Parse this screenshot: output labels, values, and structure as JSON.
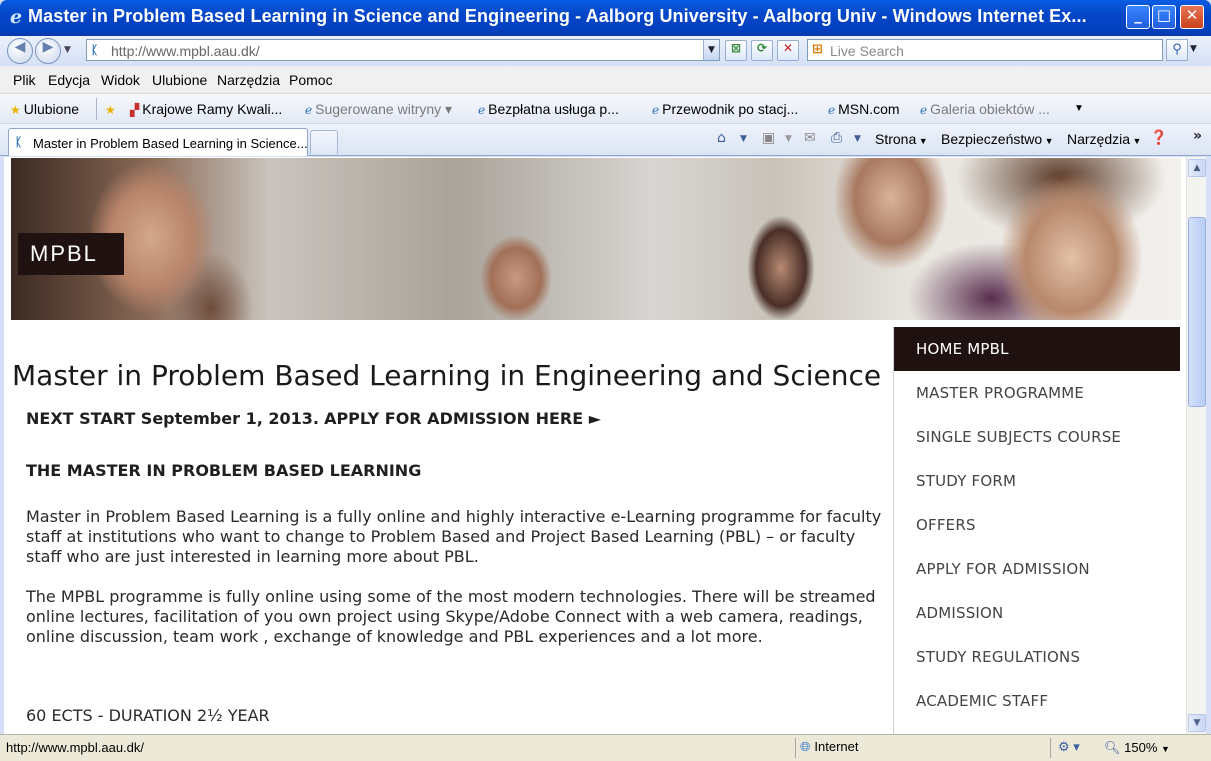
{
  "window": {
    "title": "Master in Problem Based Learning in Science and Engineering - Aalborg University - Aalborg Univ - Windows Internet Ex...",
    "min_label": "_",
    "max_label": "□",
    "close_label": "✕"
  },
  "address_bar": {
    "url": "http://www.mpbl.aau.dk/",
    "search_placeholder": "Live Search"
  },
  "menu": [
    "Plik",
    "Edycja",
    "Widok",
    "Ulubione",
    "Narzędzia",
    "Pomoc"
  ],
  "favorites": {
    "label": "Ulubione",
    "items": [
      {
        "label": "Krajowe Ramy Kwali...",
        "dim": false
      },
      {
        "label": "Sugerowane witryny ▾",
        "dim": true
      },
      {
        "label": "Bezpłatna usługa p...",
        "dim": false
      },
      {
        "label": "Przewodnik po stacj...",
        "dim": false
      },
      {
        "label": "MSN.com",
        "dim": false
      },
      {
        "label": "Galeria obiektów ...",
        "dim": true
      }
    ]
  },
  "tab": {
    "title": "Master in Problem Based Learning in Science..."
  },
  "command_bar": {
    "page": "Strona",
    "safety": "Bezpieczeństwo",
    "tools": "Narzędzia"
  },
  "page": {
    "logo": "MPBL",
    "title": "Master in Problem Based Learning in Engineering and Science",
    "next_start": "NEXT START September 1, 2013.",
    "apply_link": "APPLY FOR ADMISSION HERE ►",
    "section_heading": "THE MASTER IN PROBLEM BASED LEARNING",
    "paragraph1": "Master in Problem Based Learning is a fully online and highly interactive e-Learning programme for faculty staff at institutions who want to change to Problem Based and Project Based Learning (PBL) – or faculty staff who are just interested in learning more about PBL.",
    "paragraph2": "The MPBL programme is fully online using some of the most modern technologies. There will be streamed online lectures, facilitation of you own project using Skype/Adobe Connect with a web camera, readings, online discussion, team work , exchange of knowledge and PBL experiences and a lot more.",
    "ects": "60 ECTS - DURATION 2½ YEAR"
  },
  "sidenav": {
    "items": [
      {
        "label": "HOME MPBL",
        "active": true
      },
      {
        "label": "MASTER PROGRAMME",
        "active": false
      },
      {
        "label": "SINGLE SUBJECTS COURSE",
        "active": false
      },
      {
        "label": "STUDY FORM",
        "active": false
      },
      {
        "label": "OFFERS",
        "active": false
      },
      {
        "label": "APPLY FOR ADMISSION",
        "active": false
      },
      {
        "label": "ADMISSION",
        "active": false
      },
      {
        "label": "STUDY REGULATIONS",
        "active": false
      },
      {
        "label": "ACADEMIC STAFF",
        "active": false
      }
    ]
  },
  "status_bar": {
    "url": "http://www.mpbl.aau.dk/",
    "zone": "Internet",
    "zoom": "150%"
  },
  "colors": {
    "titlebar": "#0446c8",
    "nav_active_bg": "#1f1210",
    "logo_bg": "#1f1210"
  }
}
